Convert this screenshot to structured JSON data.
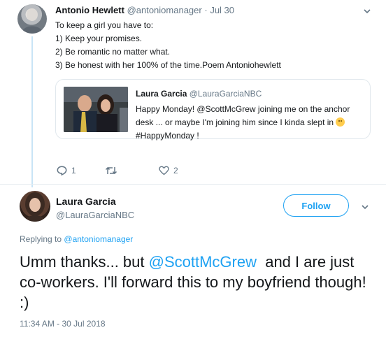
{
  "parent": {
    "name": "Antonio Hewlett",
    "handle": "@antoniomanager",
    "separator": "·",
    "date": "Jul 30",
    "lines": [
      "To keep a girl you have to:",
      "1) Keep your promises.",
      "2) Be romantic no matter what.",
      "3) Be honest with her 100% of the time.Poem Antoniohewlett"
    ],
    "quote": {
      "name": "Laura Garcia",
      "handle": "@LauraGarciaNBC",
      "text_before_emoji": "Happy Monday! @ScottMcGrew joining me on the anchor desk ... or maybe I'm joining him since I kinda slept in",
      "hashtag_line": "#HappyMonday !"
    },
    "actions": {
      "reply_count": "1",
      "retweet_count": "",
      "like_count": "2"
    }
  },
  "main": {
    "name": "Laura Garcia",
    "handle": "@LauraGarciaNBC",
    "follow_label": "Follow",
    "replying_prefix": "Replying to",
    "replying_handle": "@antoniomanager",
    "text_before": "Umm thanks... but ",
    "mention": "@ScottMcGrew",
    "text_after": "  and I are just co-workers. I'll forward this to my boyfriend though! :)",
    "timestamp": "11:34 AM - 30 Jul 2018"
  },
  "colors": {
    "accent": "#1da1f2",
    "muted": "#657786",
    "text": "#14171a",
    "thread_line": "#c9e4f6",
    "border": "#e1e8ed"
  },
  "icons": {
    "reply": "reply-icon",
    "retweet": "retweet-icon",
    "like": "heart-icon",
    "more": "chevron-down-icon"
  }
}
